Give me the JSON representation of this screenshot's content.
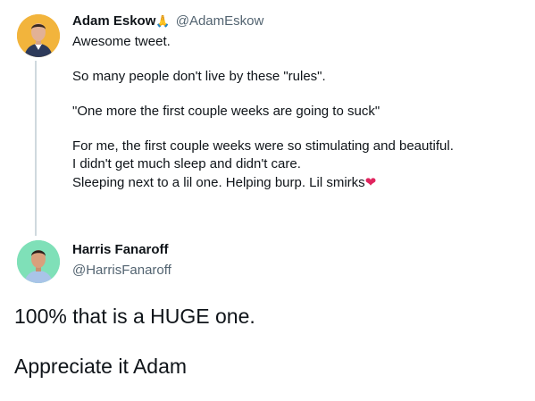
{
  "reply_tweet": {
    "author_name": "Adam Eskow",
    "author_emoji": "🙏",
    "handle": "@AdamEskow",
    "lines": [
      "Awesome tweet.",
      "So many people don't live by these \"rules\".",
      "\"One more the first couple weeks are going to suck\"",
      "For me, the first couple weeks were so stimulating and beautiful.",
      "I didn't get much sleep and didn't care.",
      "Sleeping next to a lil one. Helping burp. Lil smirks"
    ],
    "end_emoji": "❤"
  },
  "main_tweet": {
    "author_name": "Harris Fanaroff",
    "handle": "@HarrisFanaroff",
    "lines": [
      "100% that is a HUGE one.",
      "Appreciate it Adam"
    ]
  },
  "colors": {
    "text": "#0f1419",
    "secondary": "#536471",
    "thread_line": "#cfd9de",
    "heart": "#e0245e"
  }
}
